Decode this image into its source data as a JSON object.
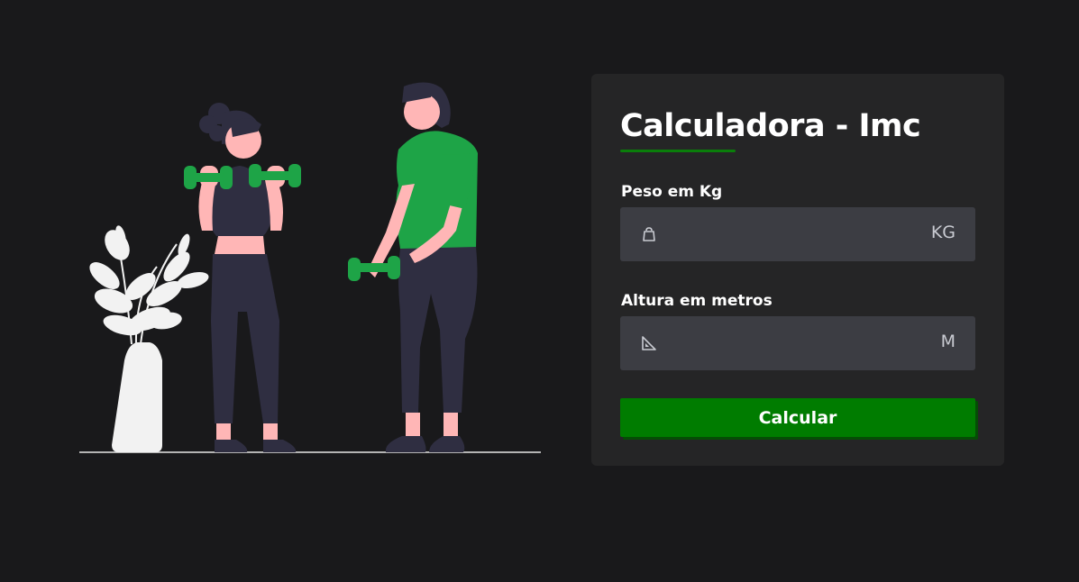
{
  "form": {
    "title": "Calculadora - Imc",
    "weight": {
      "label": "Peso em Kg",
      "value": "",
      "placeholder": "",
      "unit": "KG",
      "icon": "weight-icon"
    },
    "height": {
      "label": "Altura em metros",
      "value": "",
      "placeholder": "",
      "unit": "M",
      "icon": "ruler-icon"
    },
    "submit_label": "Calcular"
  },
  "colors": {
    "background": "#19191b",
    "card": "#252526",
    "input": "#3c3d43",
    "accent": "#007c00",
    "figure_shirt": "#1ea447"
  }
}
